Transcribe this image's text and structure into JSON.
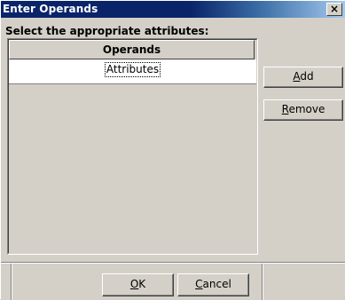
{
  "window": {
    "title": "Enter Operands",
    "close_glyph": "×",
    "close_icon": "close-icon"
  },
  "prompt": "Select the appropriate attributes:",
  "list": {
    "column_header": "Operands",
    "rows": [
      {
        "value": "Attributes",
        "focused": true
      }
    ]
  },
  "buttons": {
    "add": {
      "pre": "",
      "mnemonic": "A",
      "post": "dd"
    },
    "remove": {
      "pre": "",
      "mnemonic": "R",
      "post": "emove"
    },
    "ok": {
      "pre": "",
      "mnemonic": "O",
      "post": "K"
    },
    "cancel": {
      "pre": "",
      "mnemonic": "C",
      "post": "ancel"
    }
  },
  "colors": {
    "title_bar_start": "#0a246a",
    "title_bar_end": "#a6caf0",
    "face": "#d4d0c8"
  }
}
